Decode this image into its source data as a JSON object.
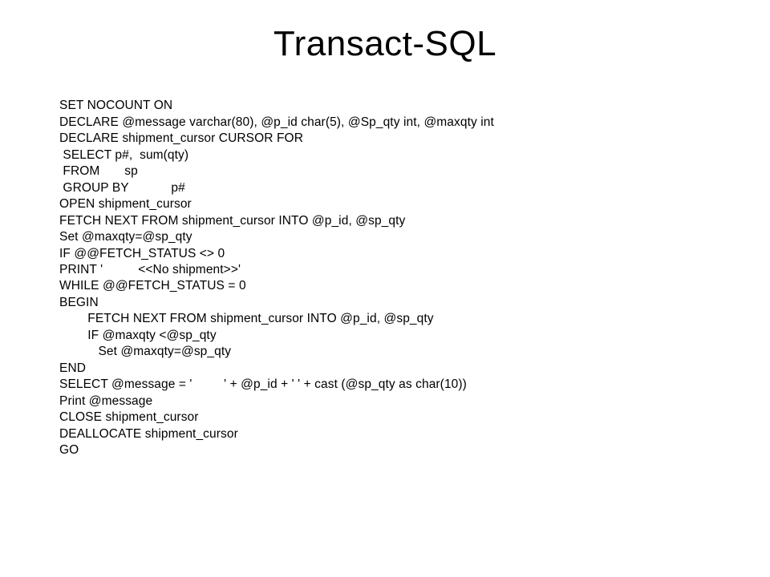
{
  "title": "Transact-SQL",
  "code": {
    "l01": "SET NOCOUNT ON",
    "l02": "DECLARE @message varchar(80), @p_id char(5), @Sp_qty int, @maxqty int",
    "l03": "DECLARE shipment_cursor CURSOR FOR",
    "l04": " SELECT p#,  sum(qty)",
    "l05": " FROM       sp",
    "l06": " GROUP BY            p#",
    "l07": "OPEN shipment_cursor",
    "l08": "FETCH NEXT FROM shipment_cursor INTO @p_id, @sp_qty",
    "l09": "Set @maxqty=@sp_qty",
    "l10": "IF @@FETCH_STATUS <> 0",
    "l11": "PRINT '          <<No shipment>>'",
    "l12": "WHILE @@FETCH_STATUS = 0",
    "l13": "BEGIN",
    "l14": "        FETCH NEXT FROM shipment_cursor INTO @p_id, @sp_qty",
    "l15": "        IF @maxqty <@sp_qty",
    "l16": "           Set @maxqty=@sp_qty",
    "l17": "END",
    "l18": "SELECT @message = '         ' + @p_id + ' ' + cast (@sp_qty as char(10))",
    "l19": "Print @message",
    "l20": "CLOSE shipment_cursor",
    "l21": "DEALLOCATE shipment_cursor",
    "l22": "GO"
  }
}
